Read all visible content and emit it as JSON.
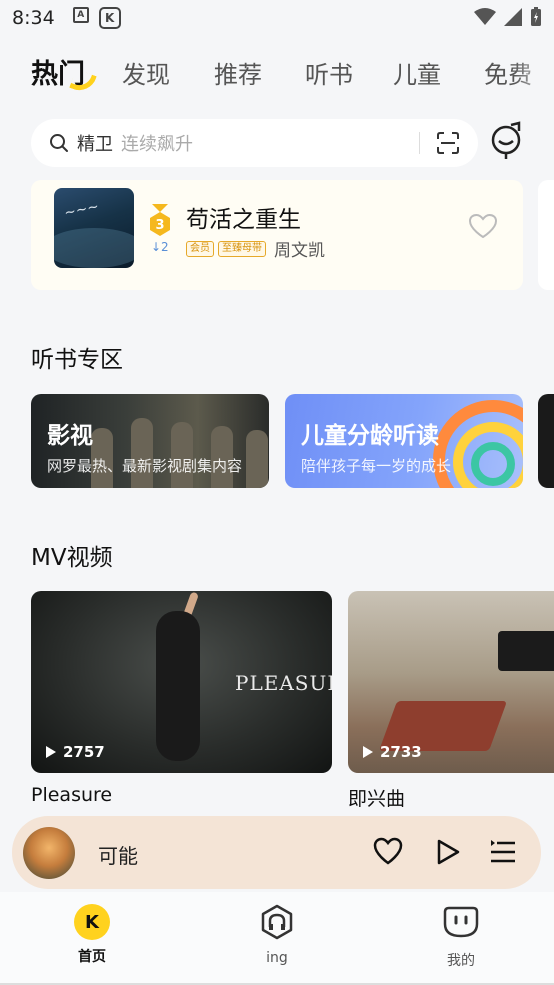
{
  "status": {
    "time": "8:34",
    "left_icons": [
      "A",
      "K"
    ]
  },
  "top_tabs": [
    {
      "label": "热门",
      "active": true
    },
    {
      "label": "发现"
    },
    {
      "label": "推荐"
    },
    {
      "label": "听书"
    },
    {
      "label": "儿童"
    },
    {
      "label": "免费"
    }
  ],
  "search": {
    "keyword": "精卫",
    "hint": "连续飙升"
  },
  "rank_item": {
    "rank": "3",
    "change": "↓2",
    "title": "苟活之重生",
    "badges": [
      "会员",
      "至臻母带"
    ],
    "author": "周文凯"
  },
  "book_section": {
    "title": "听书专区",
    "cards": [
      {
        "title": "影视",
        "subtitle": "网罗最热、最新影视剧集内容"
      },
      {
        "title": "儿童分龄听读",
        "subtitle": "陪伴孩子每一岁的成长"
      }
    ]
  },
  "mv_section": {
    "title": "MV视频",
    "videos": [
      {
        "title": "Pleasure",
        "plays": "2757",
        "overlay": "PLEASURE"
      },
      {
        "title": "即兴曲",
        "plays": "2733"
      }
    ]
  },
  "player": {
    "title": "可能"
  },
  "bottom_nav": [
    {
      "label": "首页",
      "active": true,
      "icon": "home-k-icon"
    },
    {
      "label": "ing",
      "icon": "headphones-icon"
    },
    {
      "label": "我的",
      "icon": "profile-face-icon"
    }
  ],
  "colors": {
    "accent": "#ffd21e",
    "player_bg": "#f4e4d6",
    "page_bg": "#f5f6f8"
  }
}
